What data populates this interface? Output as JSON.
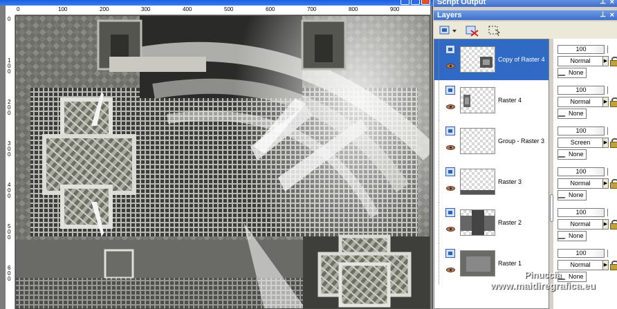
{
  "document": {
    "title": "",
    "ruler_top_labels": [
      "0",
      "100",
      "200",
      "300",
      "400",
      "500",
      "600",
      "700",
      "800",
      "900"
    ],
    "ruler_left_labels": [
      "0",
      "100",
      "200",
      "300",
      "400",
      "500",
      "600"
    ]
  },
  "script_output": {
    "title": "Script Output"
  },
  "layers_panel": {
    "title": "Layers",
    "layers": [
      {
        "name": "Copy of Raster 4",
        "opacity": "100",
        "blend": "Normal",
        "mask": "None",
        "selected": true,
        "thumb": "copy-raster4"
      },
      {
        "name": "Raster 4",
        "opacity": "100",
        "blend": "Normal",
        "mask": "None",
        "selected": false,
        "thumb": "raster4"
      },
      {
        "name": "Group - Raster 3",
        "opacity": "100",
        "blend": "Screen",
        "mask": "None",
        "selected": false,
        "thumb": "group"
      },
      {
        "name": "Raster 3",
        "opacity": "100",
        "blend": "Normal",
        "mask": "None",
        "selected": false,
        "thumb": "raster3"
      },
      {
        "name": "Raster 2",
        "opacity": "100",
        "blend": "Normal",
        "mask": "None",
        "selected": false,
        "thumb": "raster2"
      },
      {
        "name": "Raster 1",
        "opacity": "100",
        "blend": "Normal",
        "mask": "None",
        "selected": false,
        "thumb": "raster1"
      }
    ]
  },
  "watermark": {
    "line1": "Pinuccia",
    "line2": "www.maidiregrafica.eu"
  },
  "colors": {
    "selection": "#316ac5",
    "panel_header": "#3f6fc9",
    "title_bar": "#0a52d6"
  }
}
